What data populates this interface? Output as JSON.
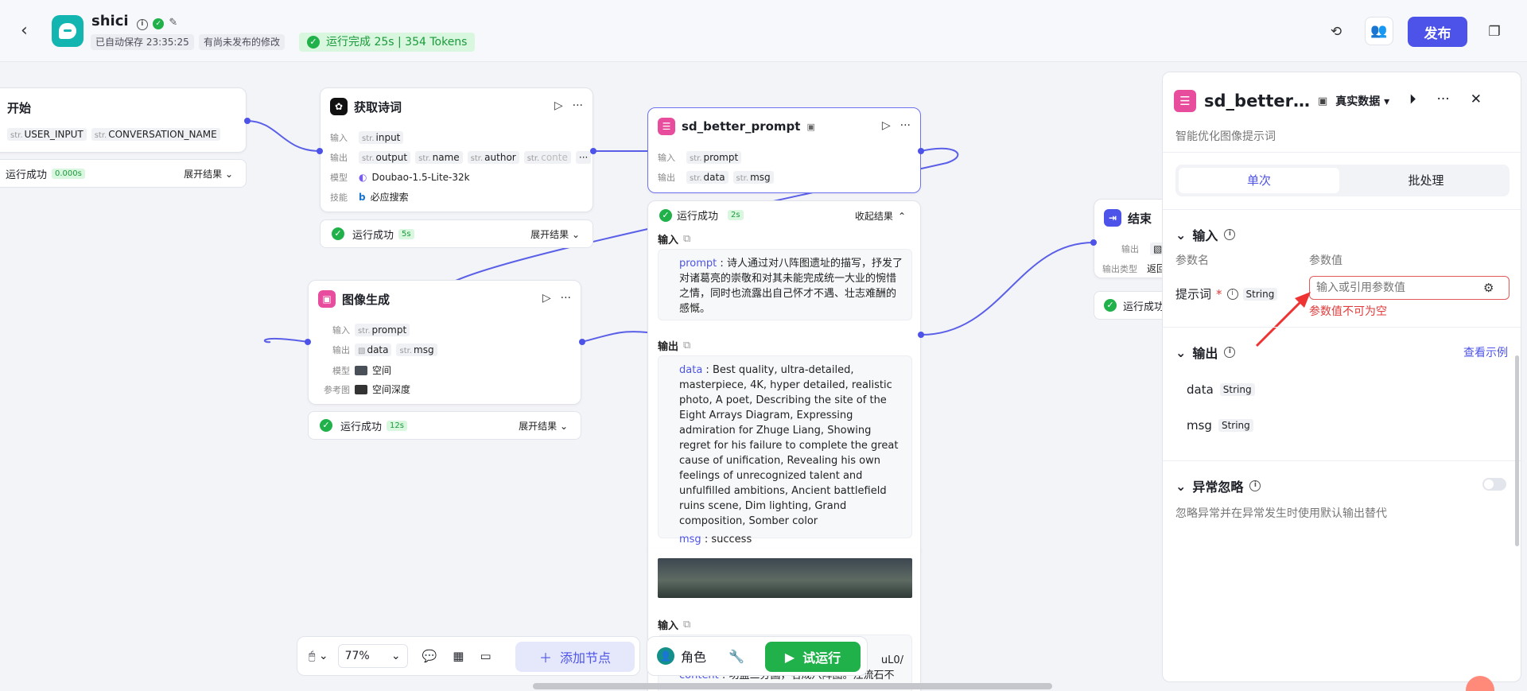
{
  "header": {
    "app_name": "shici",
    "autosave": "已自动保存 23:35:25",
    "unpublished": "有尚未发布的修改",
    "run_status": "运行完成 25s | 354 Tokens",
    "publish_label": "发布"
  },
  "nodes": {
    "start": {
      "title": "开始",
      "vars": [
        "USER_INPUT",
        "CONVERSATION_NAME"
      ],
      "status": "运行成功",
      "time": "0.000s",
      "expand": "展开结果"
    },
    "poem": {
      "title": "获取诗词",
      "in_label": "输入",
      "out_label": "输出",
      "model_label": "模型",
      "skill_label": "技能",
      "inputs": [
        "input"
      ],
      "outputs": [
        "output",
        "name",
        "author",
        "conte"
      ],
      "model": "Doubao-1.5-Lite-32k",
      "skill": "必应搜索",
      "status": "运行成功",
      "time": "5s",
      "expand": "展开结果"
    },
    "image": {
      "title": "图像生成",
      "in_label": "输入",
      "out_label": "输出",
      "model_label": "模型",
      "ref_label": "参考图",
      "inputs": [
        "prompt"
      ],
      "outputs": [
        "data",
        "msg"
      ],
      "model": "空间",
      "ref": "空间深度",
      "status": "运行成功",
      "time": "12s",
      "expand": "展开结果"
    },
    "sd": {
      "title": "sd_better_prompt",
      "in_label": "输入",
      "out_label": "输出",
      "inputs": [
        "prompt"
      ],
      "outputs": [
        "data",
        "msg"
      ],
      "status": "运行成功",
      "time": "2s",
      "collapse": "收起结果",
      "result_in_label": "输入",
      "result_out_label": "输出",
      "prompt_key": "prompt",
      "prompt_val": "诗人通过对八阵图遗址的描写，抒发了对诸葛亮的崇敬和对其未能完成统一大业的惋惜之情，同时也流露出自己怀才不遇、壮志难酬的感慨。",
      "data_key": "data",
      "data_val": "Best quality, ultra-detailed, masterpiece, 4K, hyper detailed, realistic photo, A poet, Describing the site of the Eight Arrays Diagram, Expressing admiration for Zhuge Liang, Showing regret for his failure to complete the great cause of unification, Revealing his own feelings of unrecognized talent and unfulfilled ambitions, Ancient battlefield ruins scene, Dim lighting, Grand composition, Somber color",
      "msg_key": "msg",
      "msg_val": "success",
      "lower_in_label": "输入",
      "lower_frag": "uL0/",
      "lower_content_key": "content",
      "lower_content_val": "功盖三分国，名成八阵图。江流石不"
    },
    "end": {
      "title": "结束",
      "out_label": "输出",
      "type_label": "输出类型",
      "type_val": "返回",
      "status": "运行成功"
    }
  },
  "panel": {
    "title": "sd_better…",
    "data_mode": "真实数据",
    "subtitle": "智能优化图像提示词",
    "tab_single": "单次",
    "tab_batch": "批处理",
    "input_title": "输入",
    "col_name": "参数名",
    "col_value": "参数值",
    "param_name": "提示词",
    "param_type": "String",
    "placeholder": "输入或引用参数值",
    "error": "参数值不可为空",
    "output_title": "输出",
    "view_example": "查看示例",
    "outputs": [
      {
        "name": "data",
        "type": "String"
      },
      {
        "name": "msg",
        "type": "String"
      }
    ],
    "ignore_title": "异常忽略",
    "ignore_desc": "忽略异常并在异常发生时使用默认输出替代"
  },
  "toolbar": {
    "zoom": "77%",
    "add_node": "添加节点",
    "role": "角色",
    "test_run": "试运行"
  }
}
